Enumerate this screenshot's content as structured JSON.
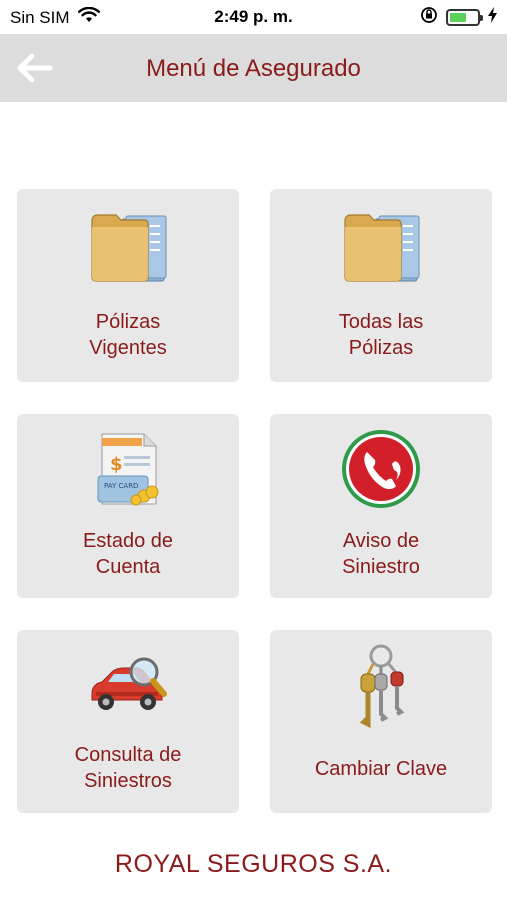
{
  "status_bar": {
    "carrier": "Sin SIM",
    "time": "2:49 p. m.",
    "battery_level": 0.6,
    "icons": [
      "wifi-icon",
      "orientation-lock-icon",
      "battery-icon",
      "charging-bolt-icon"
    ]
  },
  "nav": {
    "title": "Menú de Asegurado",
    "back_icon": "arrow-left-icon"
  },
  "tiles": [
    {
      "line1": "Pólizas",
      "line2": "Vigentes",
      "icon": "folder-icon"
    },
    {
      "line1": "Todas las",
      "line2": "Pólizas",
      "icon": "folder-icon"
    },
    {
      "line1": "Estado de",
      "line2": "Cuenta",
      "icon": "pay-card-statement-icon"
    },
    {
      "line1": "Aviso de",
      "line2": "Siniestro",
      "icon": "phone-alert-icon"
    },
    {
      "line1": "Consulta de",
      "line2": "Siniestros",
      "icon": "car-magnifier-icon"
    },
    {
      "line1": "Cambiar Clave",
      "line2": "",
      "icon": "keys-icon"
    }
  ],
  "footer": {
    "company": "ROYAL SEGUROS S.A."
  },
  "colors": {
    "accent": "#8b1a1a",
    "nav_bg": "#dcdcdc",
    "tile_bg": "#e8e8e8"
  }
}
